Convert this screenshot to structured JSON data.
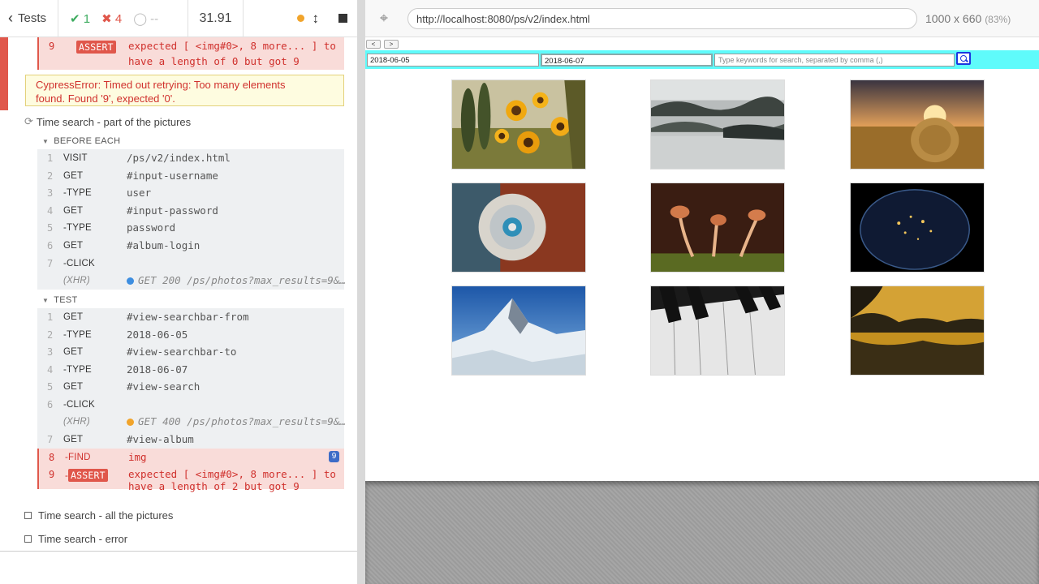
{
  "reporter": {
    "tests_label": "Tests",
    "passed": "1",
    "failed": "4",
    "pending": "--",
    "duration": "31.91",
    "prev_failure": {
      "num": "9",
      "name": "ASSERT",
      "msg_line1": "expected [ <img#0>, 8 more... ] to",
      "msg_line2": "have a length of 0 but got 9"
    },
    "error": {
      "line1": "CypressError: Timed out retrying: Too many elements",
      "line2": "found. Found '9', expected '0'."
    },
    "current_test": "Time search - part of the pictures",
    "before_each_label": "BEFORE EACH",
    "before_each": [
      {
        "num": "1",
        "name": "VISIT",
        "msg": "/ps/v2/index.html"
      },
      {
        "num": "2",
        "name": "GET",
        "msg": "#input-username"
      },
      {
        "num": "3",
        "name": "-TYPE",
        "msg": "user"
      },
      {
        "num": "4",
        "name": "GET",
        "msg": "#input-password"
      },
      {
        "num": "5",
        "name": "-TYPE",
        "msg": "password"
      },
      {
        "num": "6",
        "name": "GET",
        "msg": "#album-login"
      },
      {
        "num": "7",
        "name": "-CLICK",
        "msg": ""
      },
      {
        "num": "",
        "name": "(XHR)",
        "msg": "GET 200 /ps/photos?max_results=9&…"
      }
    ],
    "test_label": "TEST",
    "test_cmds": [
      {
        "num": "1",
        "name": "GET",
        "msg": "#view-searchbar-from"
      },
      {
        "num": "2",
        "name": "-TYPE",
        "msg": "2018-06-05"
      },
      {
        "num": "3",
        "name": "GET",
        "msg": "#view-searchbar-to"
      },
      {
        "num": "4",
        "name": "-TYPE",
        "msg": "2018-06-07"
      },
      {
        "num": "5",
        "name": "GET",
        "msg": "#view-search"
      },
      {
        "num": "6",
        "name": "-CLICK",
        "msg": ""
      },
      {
        "num": "",
        "name": "(XHR)",
        "msg": "GET 400 /ps/photos?max_results=9&…"
      },
      {
        "num": "7",
        "name": "GET",
        "msg": "#view-album"
      },
      {
        "num": "8",
        "name": "-FIND",
        "msg": "img",
        "badge": "9"
      },
      {
        "num": "9",
        "name": "ASSERT",
        "msg_line1": "expected [ <img#0>, 8 more... ] to",
        "msg_line2": "have a length of 2 but got 9"
      }
    ],
    "other_tests": [
      "Time search - all the pictures",
      "Time search - error"
    ],
    "xhr_colors": {
      "ok": "#3d8ee0",
      "bad": "#f1a42b"
    }
  },
  "aut": {
    "url": "http://localhost:8080/ps/v2/index.html",
    "viewport": "1000 x 660",
    "scale": "(83%)",
    "prev_btn": "<",
    "next_btn": ">",
    "from_date": "2018-06-05",
    "to_date": "2018-06-07",
    "keywords_placeholder": "Type keywords for search, separated by comma (,)",
    "photos": [
      "sunflowers",
      "misty-hills",
      "hay-bale",
      "dandelion",
      "mushrooms",
      "earth-night",
      "matterhorn",
      "piano-keys",
      "sunset-lake"
    ]
  }
}
